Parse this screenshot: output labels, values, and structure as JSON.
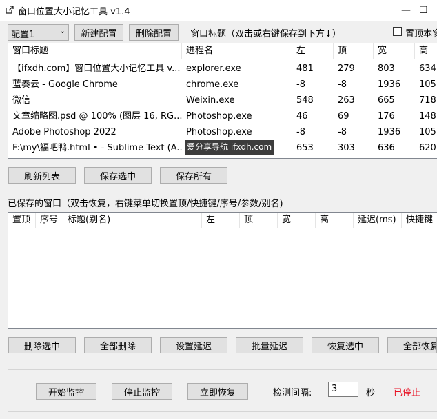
{
  "window": {
    "title": "窗口位置大小记忆工具 v1.4",
    "app_icon": "external-link-icon",
    "controls": {
      "minimize": "—",
      "maximize": "☐"
    }
  },
  "toolbar": {
    "profile_value": "配置1",
    "new_profile": "新建配置",
    "delete_profile": "删除配置",
    "hint": "窗口标题（双击或右键保存到下方↓）",
    "topmost_label": "置顶本窗"
  },
  "window_list": {
    "columns": [
      "窗口标题",
      "进程名",
      "左",
      "顶",
      "宽",
      "高"
    ],
    "rows": [
      [
        "【ifxdh.com】窗口位置大小记忆工具 v...",
        "explorer.exe",
        "481",
        "279",
        "803",
        "634"
      ],
      [
        "蓝奏云 - Google Chrome",
        "chrome.exe",
        "-8",
        "-8",
        "1936",
        "105"
      ],
      [
        "微信",
        "Weixin.exe",
        "548",
        "263",
        "665",
        "718"
      ],
      [
        "文章缩略图.psd @ 100% (图层 16, RG...",
        "Photoshop.exe",
        "46",
        "69",
        "176",
        "148"
      ],
      [
        "Adobe Photoshop 2022",
        "Photoshop.exe",
        "-8",
        "-8",
        "1936",
        "105"
      ],
      [
        "F:\\my\\福吧鸭.html • - Sublime Text (A...",
        "",
        "653",
        "303",
        "636",
        "620"
      ]
    ],
    "tooltip": "爱分享导航 ifxdh.com"
  },
  "list_actions": {
    "refresh": "刷新列表",
    "save_selected": "保存选中",
    "save_all": "保存所有"
  },
  "saved": {
    "title": "已保存的窗口（双击恢复，右键菜单切换置顶/快捷键/序号/参数/别名)",
    "columns": [
      "置顶",
      "序号",
      "标题(别名)",
      "左",
      "顶",
      "宽",
      "高",
      "延迟(ms)",
      "快捷键"
    ]
  },
  "saved_actions": {
    "delete_selected": "删除选中",
    "delete_all": "全部删除",
    "set_delay": "设置延迟",
    "batch_delay": "批量延迟",
    "restore_selected": "恢复选中",
    "restore_all": "全部恢复"
  },
  "monitor": {
    "start": "开始监控",
    "stop": "停止监控",
    "restore_now": "立即恢复",
    "interval_label": "检测间隔:",
    "interval_value": "3",
    "unit": "秒",
    "status": "已停止",
    "status_color": "#e81123"
  }
}
